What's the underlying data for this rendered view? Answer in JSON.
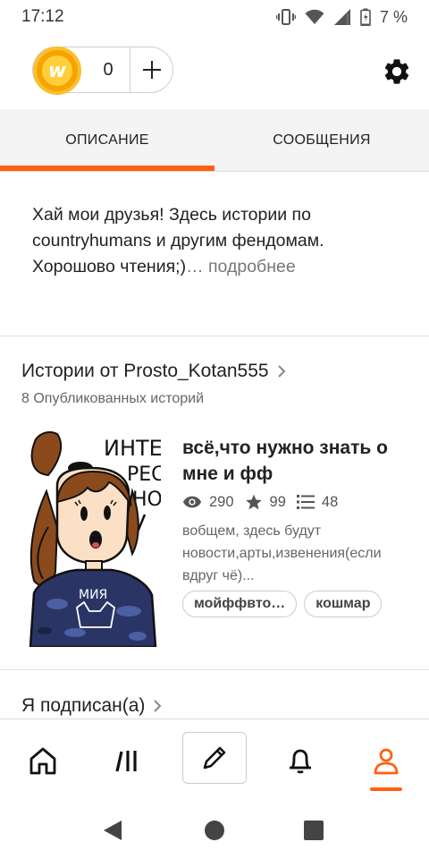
{
  "status_bar": {
    "time": "17:12",
    "battery": "7 %"
  },
  "wallet": {
    "coins": "0",
    "coin_letter": "w"
  },
  "tabs": [
    {
      "label": "ОПИСАНИЕ"
    },
    {
      "label": "СООБЩЕНИЯ"
    }
  ],
  "about": {
    "text": "Хай мои друзья! Здесь истории по countryhumans и другим фендомам. Хорошово чтения;)",
    "more": "… подробнее"
  },
  "stories": {
    "title": "Истории от Prosto_Kotan555",
    "count": "8 Опубликованных историй",
    "items": [
      {
        "title": "всё,что нужно знать о мне и фф",
        "reads": "290",
        "votes": "99",
        "parts": "48",
        "description": "вобщем, здесь будут новости,арты,извенения(если вдруг чё)...",
        "tags": [
          "мойффвто…",
          "кошмар"
        ],
        "cover_text": {
          "line1": "ИНТЕ-",
          "line2": "РЕС",
          "line3": "НО",
          "shirt": "МИЯ"
        }
      }
    ]
  },
  "following": {
    "title": "Я подписан(а)"
  },
  "icons": {
    "status": [
      "vibrate-icon",
      "wifi-icon",
      "signal-icon",
      "battery-icon"
    ],
    "nav": [
      "home-icon",
      "library-icon",
      "pencil-icon",
      "bell-icon",
      "profile-icon"
    ],
    "system": [
      "back-icon",
      "home-circle-icon",
      "recents-icon"
    ]
  },
  "colors": {
    "accent": "#ff6111",
    "coin": "#f5a300"
  }
}
